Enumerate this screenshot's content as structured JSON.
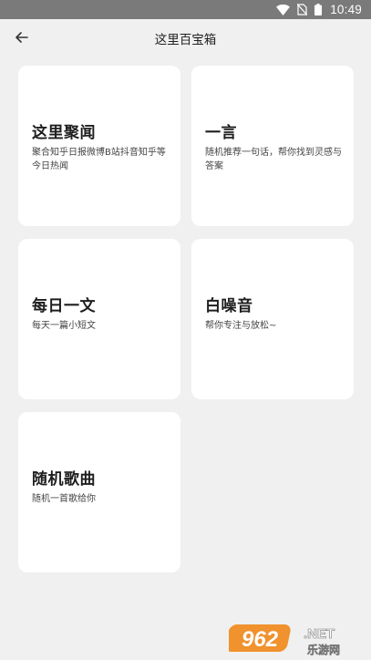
{
  "status_bar": {
    "time": "10:49",
    "icons": [
      "wifi-icon",
      "no-sim-icon",
      "battery-icon"
    ]
  },
  "app_bar": {
    "back_icon": "arrow-left-icon",
    "title": "这里百宝箱"
  },
  "cards": [
    {
      "title": "这里聚闻",
      "desc": "聚合知乎日报微博B站抖音知乎等今日热闻"
    },
    {
      "title": "一言",
      "desc": "随机推荐一句话，帮你找到灵感与答案"
    },
    {
      "title": "每日一文",
      "desc": "每天一篇小短文"
    },
    {
      "title": "白噪音",
      "desc": "帮你专注与放松~"
    },
    {
      "title": "随机歌曲",
      "desc": "随机一首歌给你"
    }
  ],
  "watermark": {
    "number": "962",
    "suffix": ".NET",
    "site": "乐游网"
  },
  "colors": {
    "background": "#f0f0f0",
    "status_bar": "#7a7a7a",
    "card": "#ffffff",
    "watermark_orange": "#f08a1c"
  }
}
